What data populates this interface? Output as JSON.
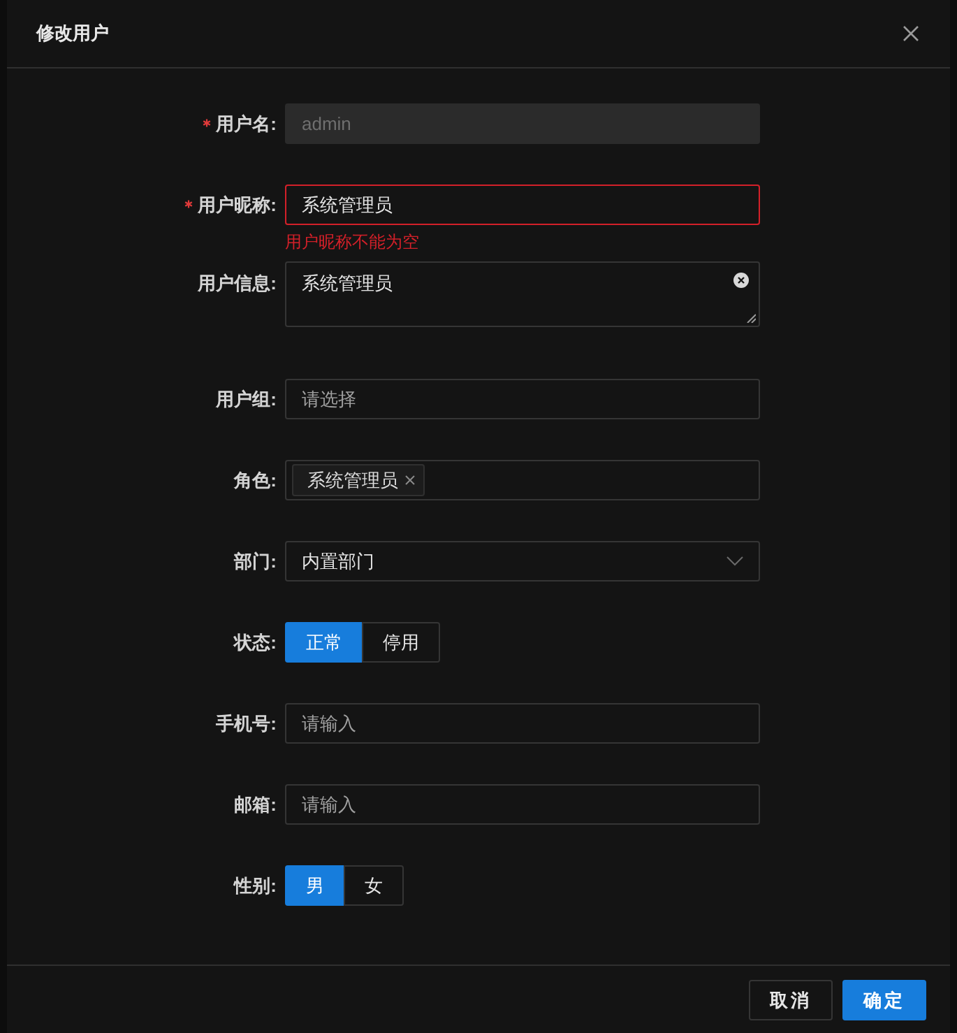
{
  "dialog": {
    "title": "修改用户"
  },
  "fields": [
    {
      "kind": "input",
      "label": "用户名:",
      "required": true,
      "disabled": true,
      "value": "admin"
    },
    {
      "kind": "input",
      "label": "用户昵称:",
      "required": true,
      "disabled": false,
      "value": "系统管理员",
      "error": "用户昵称不能为空"
    },
    {
      "kind": "textarea",
      "label": "用户信息:",
      "required": false,
      "value": "系统管理员"
    },
    {
      "kind": "input",
      "label": "用户组:",
      "required": false,
      "disabled": false,
      "placeholder": "请选择"
    },
    {
      "kind": "tags",
      "label": "角色:",
      "required": false,
      "tags": [
        "系统管理员"
      ]
    },
    {
      "kind": "select",
      "label": "部门:",
      "required": false,
      "value": "内置部门"
    },
    {
      "kind": "radio",
      "label": "状态:",
      "required": false,
      "options": [
        {
          "label": "正常",
          "selected": true
        },
        {
          "label": "停用",
          "selected": false
        }
      ]
    },
    {
      "kind": "input",
      "label": "手机号:",
      "required": false,
      "disabled": false,
      "placeholder": "请输入"
    },
    {
      "kind": "input",
      "label": "邮箱:",
      "required": false,
      "disabled": false,
      "placeholder": "请输入"
    },
    {
      "kind": "radio",
      "label": "性别:",
      "required": false,
      "options": [
        {
          "label": "男",
          "selected": true
        },
        {
          "label": "女",
          "selected": false
        }
      ]
    }
  ],
  "buttons": [
    {
      "label": "取消",
      "kind": "default"
    },
    {
      "label": "确定",
      "kind": "primary"
    }
  ]
}
